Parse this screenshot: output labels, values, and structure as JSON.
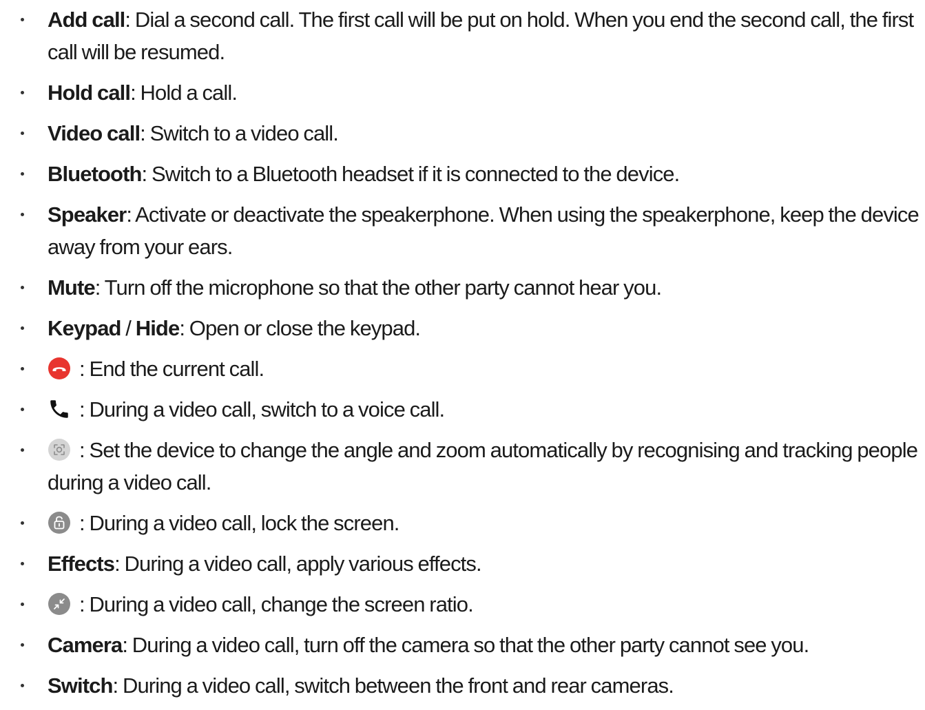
{
  "items": [
    {
      "term": "Add call",
      "sep": ": ",
      "text": "Dial a second call. The first call will be put on hold. When you end the second call, the first call will be resumed."
    },
    {
      "term": "Hold call",
      "sep": ": ",
      "text": "Hold a call."
    },
    {
      "term": "Video call",
      "sep": ": ",
      "text": "Switch to a video call."
    },
    {
      "term": "Bluetooth",
      "sep": ": ",
      "text": "Switch to a Bluetooth headset if it is connected to the device."
    },
    {
      "term": "Speaker",
      "sep": ": ",
      "text": "Activate or deactivate the speakerphone. When using the speakerphone, keep the device away from your ears."
    },
    {
      "term": "Mute",
      "sep": ": ",
      "text": "Turn off the microphone so that the other party cannot hear you."
    },
    {
      "term": "Keypad",
      "slash": " / ",
      "term2": "Hide",
      "sep": ": ",
      "text": "Open or close the keypad."
    },
    {
      "icon": "end-call-icon",
      "sep": ": ",
      "text": "End the current call."
    },
    {
      "icon": "phone-icon",
      "sep": ": ",
      "text": "During a video call, switch to a voice call."
    },
    {
      "icon": "auto-framing-icon",
      "sep": ": ",
      "text": "Set the device to change the angle and zoom automatically by recognising and tracking people during a video call."
    },
    {
      "icon": "lock-icon",
      "sep": ": ",
      "text": "During a video call, lock the screen."
    },
    {
      "term": "Effects",
      "sep": ": ",
      "text": "During a video call, apply various effects."
    },
    {
      "icon": "screen-ratio-icon",
      "sep": ": ",
      "text": "During a video call, change the screen ratio."
    },
    {
      "term": "Camera",
      "sep": ": ",
      "text": "During a video call, turn off the camera so that the other party cannot see you."
    },
    {
      "term": "Switch",
      "sep": ": ",
      "text": "During a video call, switch between the front and rear cameras."
    }
  ],
  "colors": {
    "text": "#1b1b1b",
    "end_call_red": "#e8352f",
    "icon_grey": "#8b8b8b",
    "icon_grey_light": "#a3a3a3"
  }
}
